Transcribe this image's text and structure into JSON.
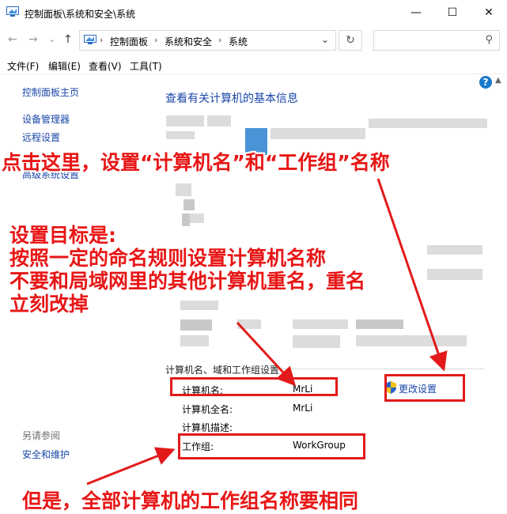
{
  "window": {
    "title": "控制面板\\系统和安全\\系统",
    "minimize_icon": "—",
    "maximize_icon": "☐",
    "close_icon": "✕"
  },
  "navigation": {
    "back_icon": "←",
    "forward_icon": "→",
    "recent_icon": "⌄",
    "up_icon": "↑",
    "breadcrumbs": [
      "控制面板",
      "系统和安全",
      "系统"
    ],
    "separator": "›",
    "dropdown_icon": "⌄",
    "refresh_icon": "↻",
    "search_icon": "⚲"
  },
  "menu": [
    "文件(F)",
    "编辑(E)",
    "查看(V)",
    "工具(T)"
  ],
  "sidebar": {
    "home": "控制面板主页",
    "items": [
      "设备管理器",
      "远程设置",
      "高级系统设置"
    ],
    "see_also_title": "另请参阅",
    "see_also_items": [
      "安全和维护"
    ]
  },
  "main": {
    "heading": "查看有关计算机的基本信息",
    "help_icon": "?",
    "section_title": "计算机名、域和工作组设置",
    "rows": [
      {
        "label": "计算机名:",
        "value": "MrLi"
      },
      {
        "label": "计算机全名:",
        "value": "MrLi"
      },
      {
        "label": "计算机描述:",
        "value": ""
      },
      {
        "label": "工作组:",
        "value": "WorkGroup"
      }
    ],
    "change_settings": "更改设置"
  },
  "annotations": {
    "top": "点击这里，设置“计算机名”和“工作组”名称",
    "middle": [
      "设置目标是:",
      "按照一定的命名规则设置计算机名称",
      "不要和局域网里的其他计算机重名，重名",
      "立刻改掉"
    ],
    "bottom": "但是，全部计算机的工作组名称要相同"
  },
  "colors": {
    "link": "#1a46a8",
    "annotation": "#e81616"
  }
}
